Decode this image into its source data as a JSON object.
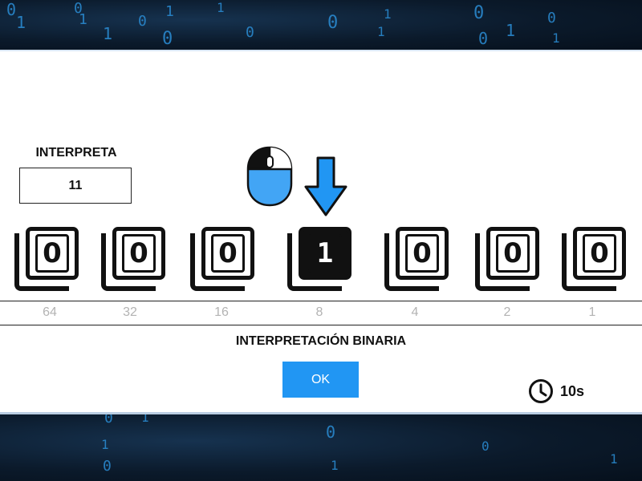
{
  "background": {
    "top_digits": [
      "0",
      "1",
      "0",
      "1",
      "1",
      "0",
      "0",
      "1",
      "1",
      "0",
      "0",
      "1",
      "1",
      "0",
      "0",
      "1",
      "0",
      "1"
    ],
    "bottom_digits": [
      "0",
      "1",
      "0",
      "1",
      "0",
      "1",
      "0",
      "1"
    ]
  },
  "prompt": {
    "label": "INTERPRETA",
    "value": "11"
  },
  "icons": {
    "hint_mouse": "mouse-left-click-icon",
    "hint_arrow": "arrow-down-icon",
    "timer": "clock-icon"
  },
  "bits": [
    {
      "value": "0",
      "weight": "64",
      "on": false
    },
    {
      "value": "0",
      "weight": "32",
      "on": false
    },
    {
      "value": "0",
      "weight": "16",
      "on": false
    },
    {
      "value": "1",
      "weight": "8",
      "on": true
    },
    {
      "value": "0",
      "weight": "4",
      "on": false
    },
    {
      "value": "0",
      "weight": "2",
      "on": false
    },
    {
      "value": "0",
      "weight": "1",
      "on": false
    }
  ],
  "title": "INTERPRETACIÓN BINARIA",
  "ok_label": "OK",
  "timer": "10s",
  "colors": {
    "accent": "#2196f3",
    "background_dark": "#0b1a2b",
    "weight_text": "#b3b3b3"
  }
}
